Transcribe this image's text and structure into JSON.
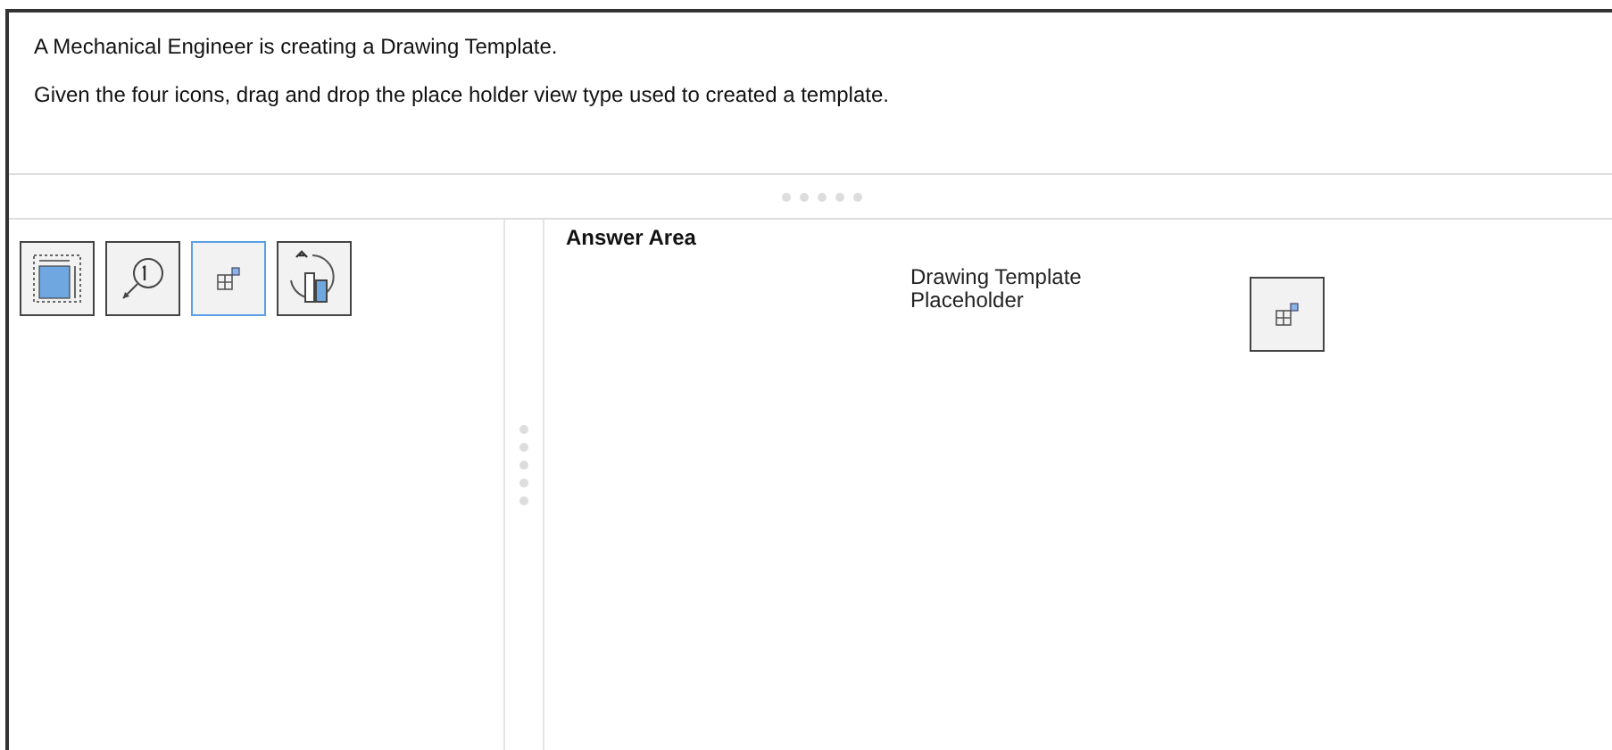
{
  "question": {
    "lines": [
      "A Mechanical Engineer is creating a Drawing Template.",
      "Given the four icons, drag and drop the place holder view type used to created a template."
    ]
  },
  "choices": [
    {
      "kind": "view-frame",
      "selected": false
    },
    {
      "kind": "detail-callout",
      "selected": false
    },
    {
      "kind": "placeholder",
      "selected": true
    },
    {
      "kind": "annotation-chart",
      "selected": false
    }
  ],
  "answer_area": {
    "title": "Answer Area",
    "label": "Drawing Template Placeholder",
    "dropped": {
      "kind": "placeholder"
    }
  }
}
